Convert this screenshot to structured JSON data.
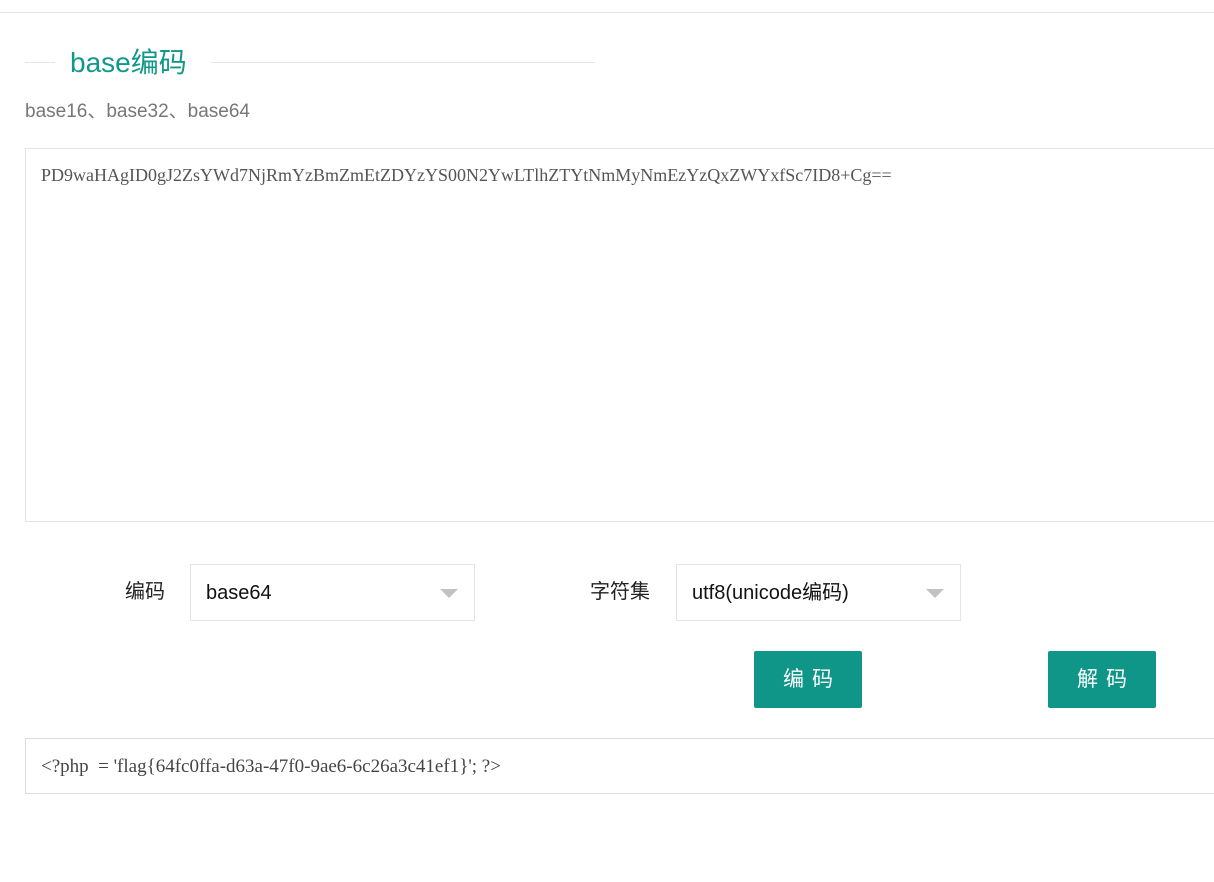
{
  "header": {
    "title": "base编码",
    "subtitle": "base16、base32、base64"
  },
  "input": {
    "value": "PD9waHAgID0gJ2ZsYWd7NjRmYzBmZmEtZDYzYS00N2YwLTlhZTYtNmMyNmEzYzQxZWYxfSc7ID8+Cg=="
  },
  "options": {
    "encoding_label": "编码",
    "encoding_value": "base64",
    "charset_label": "字符集",
    "charset_value": "utf8(unicode编码)"
  },
  "actions": {
    "encode_label": "编码",
    "decode_label": "解码"
  },
  "output": {
    "value": "<?php  = 'flag{64fc0ffa-d63a-47f0-9ae6-6c26a3c41ef1}'; ?>"
  },
  "colors": {
    "accent": "#0f9688"
  }
}
